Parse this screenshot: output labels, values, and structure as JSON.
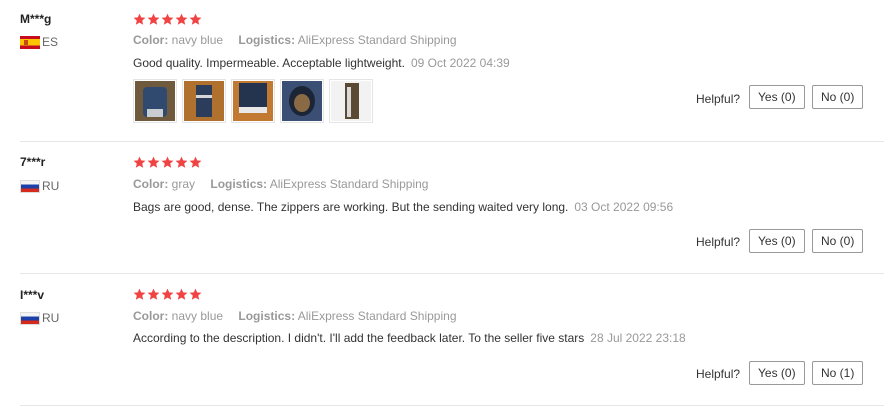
{
  "colors": {
    "star": "#f04444",
    "muted": "#999999",
    "text": "#333333"
  },
  "reviews": [
    {
      "user": "M***g",
      "country": "ES",
      "flag": "flag-es",
      "rating": 5,
      "color_label": "Color:",
      "color_value": "navy blue",
      "logistics_label": "Logistics:",
      "logistics_value": "AliExpress Standard Shipping",
      "text": "Good quality. Impermeable. Acceptable lightweight.",
      "date": "09 Oct 2022 04:39",
      "photos": [
        "photo-1",
        "photo-2",
        "photo-3",
        "photo-4",
        "photo-5"
      ],
      "helpful_label": "Helpful?",
      "yes_label": "Yes (0)",
      "no_label": "No (0)"
    },
    {
      "user": "7***r",
      "country": "RU",
      "flag": "flag-ru",
      "rating": 5,
      "color_label": "Color:",
      "color_value": "gray",
      "logistics_label": "Logistics:",
      "logistics_value": "AliExpress Standard Shipping",
      "text": "Bags are good, dense. The zippers are working. But the sending waited very long.",
      "date": "03 Oct 2022 09:56",
      "helpful_label": "Helpful?",
      "yes_label": "Yes (0)",
      "no_label": "No (0)"
    },
    {
      "user": "I***v",
      "country": "RU",
      "flag": "flag-ru",
      "rating": 5,
      "color_label": "Color:",
      "color_value": "navy blue",
      "logistics_label": "Logistics:",
      "logistics_value": "AliExpress Standard Shipping",
      "text": "According to the description. I didn't. I'll add the feedback later. To the seller five stars",
      "date": "28 Jul 2022 23:18",
      "helpful_label": "Helpful?",
      "yes_label": "Yes (0)",
      "no_label": "No (1)"
    }
  ]
}
